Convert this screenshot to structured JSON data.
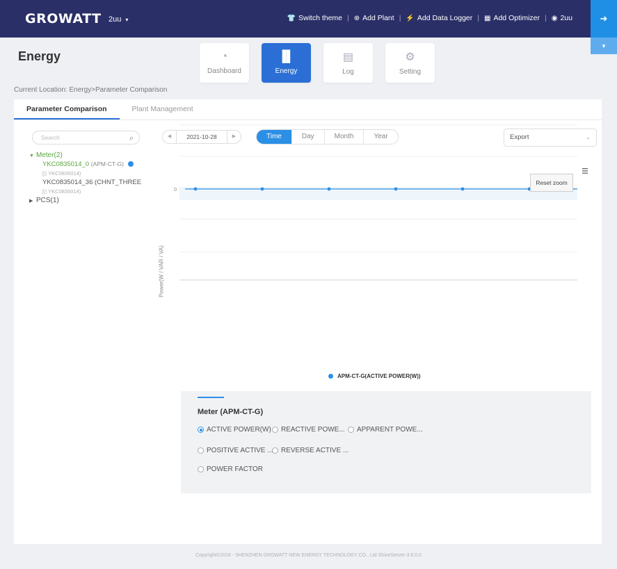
{
  "topbar": {
    "logo": "GROWATT",
    "user": "2uu",
    "actions": [
      {
        "icon": "shirt-icon",
        "label": "Switch theme"
      },
      {
        "icon": "plus-circle-icon",
        "label": "Add Plant"
      },
      {
        "icon": "plug-icon",
        "label": "Add Data Logger"
      },
      {
        "icon": "chip-icon",
        "label": "Add Optimizer"
      },
      {
        "icon": "user-circle-icon",
        "label": "2uu"
      }
    ]
  },
  "page": {
    "title": "Energy",
    "breadcrumb": "Current Location: Energy>Parameter Comparison"
  },
  "module_tabs": [
    {
      "label": "Dashboard",
      "icon": "gauge-icon",
      "active": false
    },
    {
      "label": "Energy",
      "icon": "bar-chart-icon",
      "active": true
    },
    {
      "label": "Log",
      "icon": "log-icon",
      "active": false
    },
    {
      "label": "Setting",
      "icon": "gear-icon",
      "active": false
    }
  ],
  "sub_tabs": [
    {
      "label": "Parameter Comparison",
      "active": true
    },
    {
      "label": "Plant Management",
      "active": false
    }
  ],
  "tree": {
    "search_placeholder": "Search",
    "meter_group": "Meter(2)",
    "items": [
      {
        "name": "YKC0835014_0",
        "model": "(APM-CT-G)",
        "sn": "YKC0835014",
        "selected": true
      },
      {
        "name": "YKC0835014_36",
        "model": "(CHNT_THREE",
        "sn": "YKC0835014",
        "selected": false
      }
    ],
    "pcs_group": "PCS(1)"
  },
  "date": {
    "value": "2021-10-28",
    "prev": "◀",
    "next": "▶"
  },
  "range": {
    "options": [
      "Time",
      "Day",
      "Month",
      "Year"
    ],
    "active": "Time"
  },
  "export": {
    "label": "Export"
  },
  "chart": {
    "reset_zoom": "Reset zoom",
    "menu_icon": "hamburger-icon"
  },
  "chart_data": {
    "type": "line",
    "ylabel": "Power(W / VAR / VA)",
    "xlabel": "",
    "x_tick_last": "137.5",
    "y_ticks": [
      "0"
    ],
    "series": [
      {
        "name": "APM-CT-G(ACTIVE POWER(W))",
        "color": "#2b8fe6",
        "values": [
          0,
          0,
          0,
          0,
          0,
          0
        ]
      }
    ],
    "grid": true,
    "legend_position": "bottom"
  },
  "params": {
    "title": "Meter (APM-CT-G)",
    "options": [
      {
        "label": "ACTIVE POWER(W)",
        "checked": true
      },
      {
        "label": "REACTIVE POWE...",
        "checked": false
      },
      {
        "label": "APPARENT POWE...",
        "checked": false
      },
      {
        "label": "POSITIVE ACTIVE ...",
        "checked": false
      },
      {
        "label": "REVERSE ACTIVE ...",
        "checked": false
      },
      {
        "label": "POWER FACTOR",
        "checked": false
      }
    ]
  },
  "footer": "Copyright©2018 - SHENZHEN GROWATT NEW ENERGY TECHNOLOGY CO., Ltd ShineServer-3.6.0.0",
  "colors": {
    "nav_bg": "#2a2f67",
    "accent": "#2b8fe6",
    "active_tab": "#2b6fd6",
    "tree_green": "#5aa63f"
  }
}
